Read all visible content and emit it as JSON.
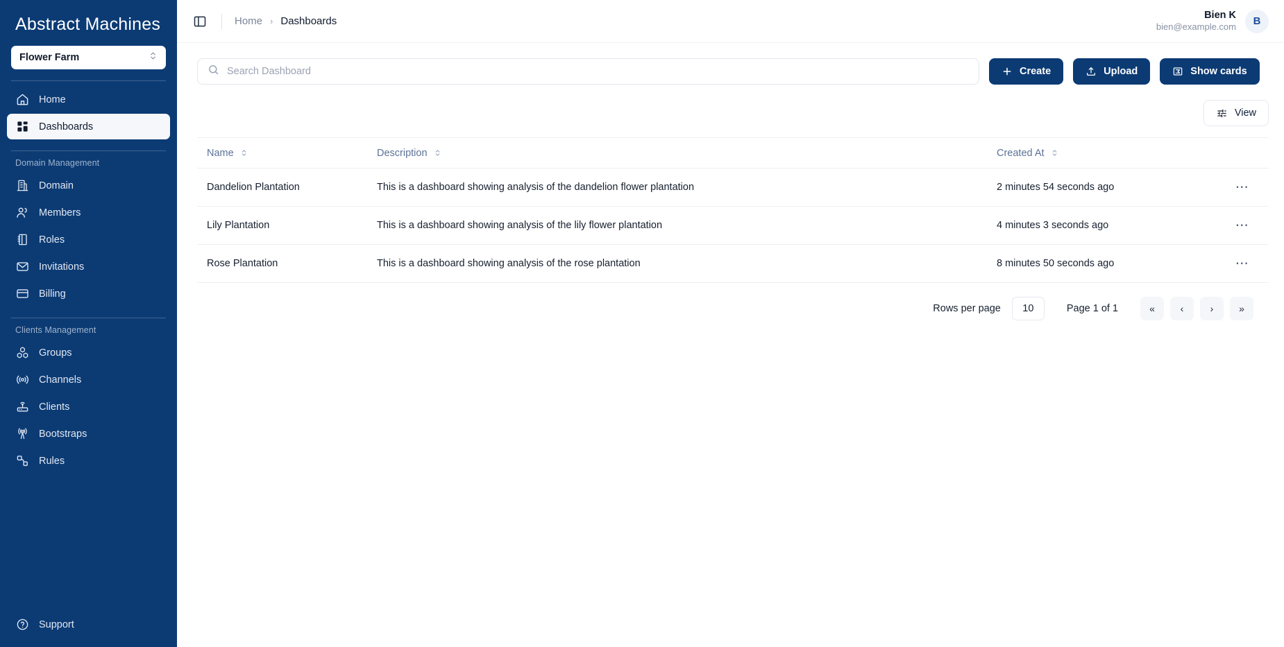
{
  "sidebar": {
    "brand": "Abstract Machines",
    "org": {
      "name": "Flower Farm",
      "icon": "chevron-updown-icon"
    },
    "primary_items": [
      {
        "label": "Home",
        "icon": "home-icon",
        "active": false
      },
      {
        "label": "Dashboards",
        "icon": "dashboard-grid-icon",
        "active": true
      }
    ],
    "sections": [
      {
        "label": "Domain Management",
        "items": [
          {
            "label": "Domain",
            "icon": "building-icon"
          },
          {
            "label": "Members",
            "icon": "users-icon"
          },
          {
            "label": "Roles",
            "icon": "notebook-icon"
          },
          {
            "label": "Invitations",
            "icon": "envelope-icon"
          },
          {
            "label": "Billing",
            "icon": "credit-card-icon"
          }
        ]
      },
      {
        "label": "Clients Management",
        "items": [
          {
            "label": "Groups",
            "icon": "cubes-icon"
          },
          {
            "label": "Channels",
            "icon": "broadcast-icon"
          },
          {
            "label": "Clients",
            "icon": "router-icon"
          },
          {
            "label": "Bootstraps",
            "icon": "antenna-icon"
          },
          {
            "label": "Rules",
            "icon": "nodes-icon"
          }
        ]
      }
    ],
    "support": {
      "label": "Support",
      "icon": "question-circle-icon"
    }
  },
  "topbar": {
    "panel_toggle_icon": "sidebar-toggle-icon",
    "breadcrumb": {
      "home": "Home",
      "separator": "›",
      "current": "Dashboards"
    },
    "user": {
      "name": "Bien K",
      "email": "bien@example.com",
      "initial": "B"
    }
  },
  "toolbar": {
    "search": {
      "placeholder": "Search Dashboard",
      "value": "",
      "icon": "search-icon"
    },
    "create_label": "Create",
    "create_icon": "plus-icon",
    "upload_label": "Upload",
    "upload_icon": "upload-icon",
    "show_cards_label": "Show cards",
    "show_cards_icon": "cards-icon",
    "view_label": "View",
    "view_icon": "sliders-icon"
  },
  "table": {
    "columns": [
      {
        "label": "Name",
        "sortable": true
      },
      {
        "label": "Description",
        "sortable": true
      },
      {
        "label": "Created At",
        "sortable": true
      }
    ],
    "rows": [
      {
        "name": "Dandelion Plantation",
        "description": "This is a dashboard showing analysis of the dandelion flower plantation",
        "created_at": "2 minutes 54 seconds ago",
        "actions_icon": "ellipsis-icon"
      },
      {
        "name": "Lily Plantation",
        "description": "This is a dashboard showing analysis of the lily flower plantation",
        "created_at": "4 minutes 3 seconds ago",
        "actions_icon": "ellipsis-icon"
      },
      {
        "name": "Rose Plantation",
        "description": "This is a dashboard showing analysis of the rose plantation",
        "created_at": "8 minutes 50 seconds ago",
        "actions_icon": "ellipsis-icon"
      }
    ]
  },
  "pagination": {
    "rows_per_page_label": "Rows per page",
    "rows_per_page_value": "10",
    "page_status": "Page 1 of 1",
    "first_label": "«",
    "prev_label": "‹",
    "next_label": "›",
    "last_label": "»"
  },
  "colors": {
    "sidebar": "#0c3b74",
    "primary": "#0c3b74",
    "accent_text": "#5b7296"
  }
}
